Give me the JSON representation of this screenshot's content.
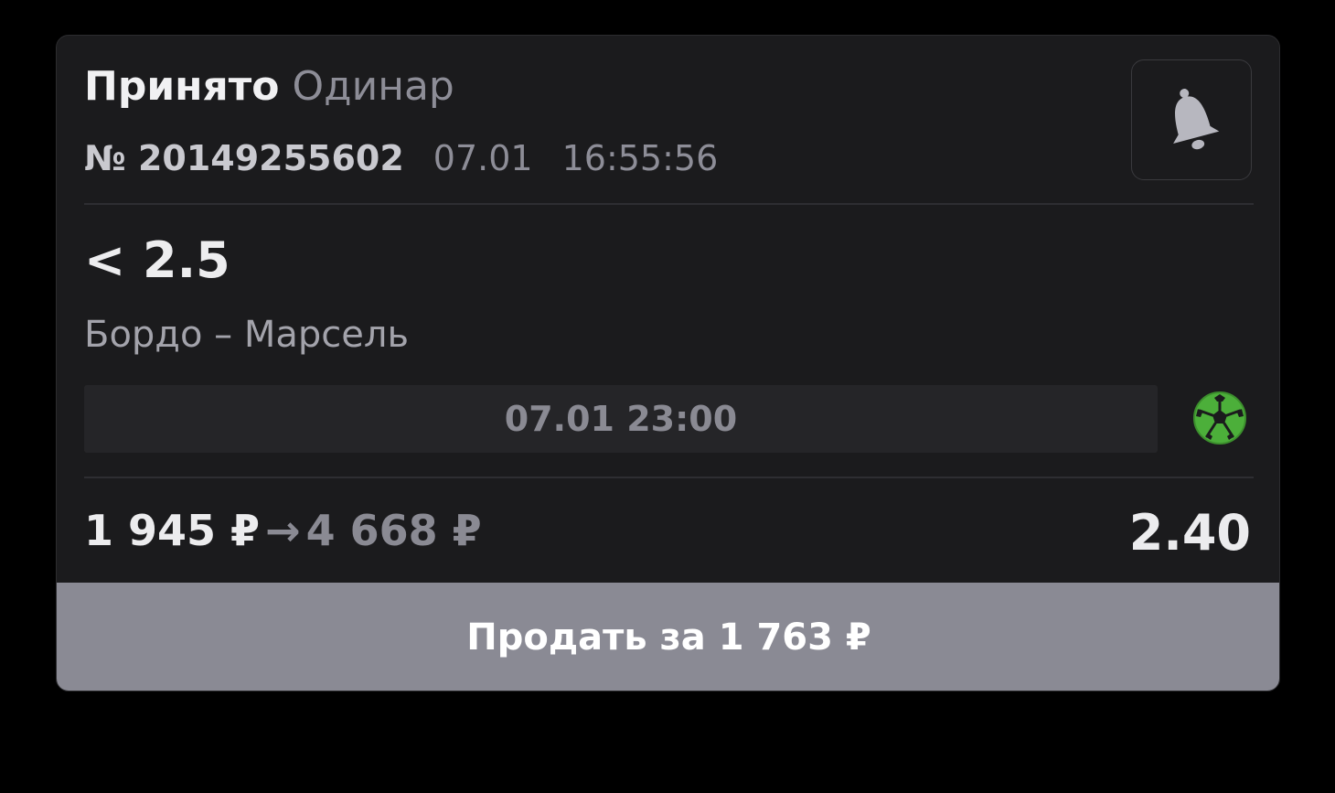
{
  "bet": {
    "status": "Принято",
    "type": "Одинар",
    "ticket": "№ 20149255602",
    "date": "07.01",
    "time": "16:55:56",
    "outcome": "< 2.5",
    "match": "Бордо – Марсель",
    "start": "07.01 23:00",
    "stake": "1 945 ₽",
    "arrow": "→",
    "payout": "4 668 ₽",
    "odds": "2.40",
    "sport_icon": "soccer-ball-icon",
    "notify_icon": "bell-icon"
  },
  "sell": {
    "label": "Продать за 1 763 ₽"
  },
  "colors": {
    "background": "#000000",
    "card": "#1b1b1d",
    "sell_button": "#8a8a94",
    "sport_icon": "#4caf3a"
  }
}
